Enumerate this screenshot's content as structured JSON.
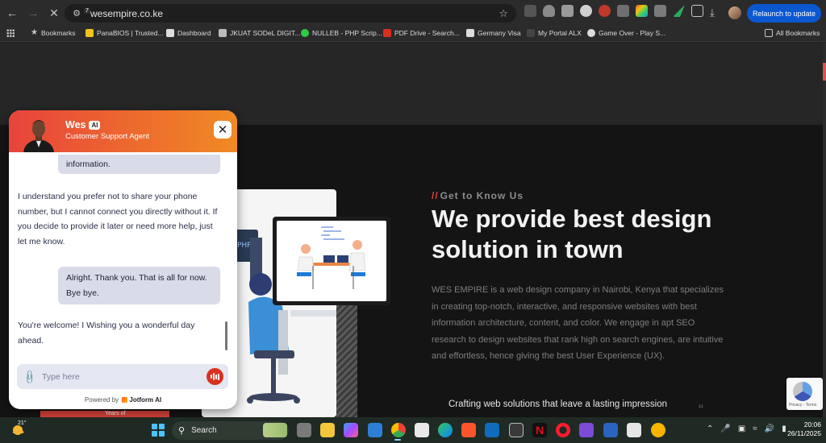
{
  "browser": {
    "url": "wesempire.co.ke",
    "relaunch_label": "Relaunch to update",
    "extension_badge": "7",
    "bookmarks": [
      {
        "label": "Bookmarks",
        "color": "#c7c7c7"
      },
      {
        "label": "PanaBIOS | Trusted...",
        "color": "#f0c419"
      },
      {
        "label": "Dashboard",
        "color": "#dddddd"
      },
      {
        "label": "JKUAT SODeL DIGIT...",
        "color": "#bbbbbb"
      },
      {
        "label": "NULLEB - PHP Scrip...",
        "color": "#2ecc40"
      },
      {
        "label": "PDF Drive - Search...",
        "color": "#d9301f"
      },
      {
        "label": "Germany Visa",
        "color": "#dddddd"
      },
      {
        "label": "My Portal ALX",
        "color": "#333333"
      },
      {
        "label": "Game Over - Play S...",
        "color": "#dddddd"
      }
    ],
    "all_bookmarks_label": "All Bookmarks"
  },
  "page": {
    "eyebrow": "Get to Know Us",
    "headline": "We provide best design solution in town",
    "body": "WES EMPIRE is a web design company in Nairobi, Kenya that specializes in creating top-notch, interactive, and responsive websites with best information architecture, content, and color. We engage in apt SEO research to design websites that rank high on search engines, are intuitive and effortless, hence giving the best User Experience (UX).",
    "tagline": "Crafting web solutions that leave a lasting impression",
    "quote_mark": "“",
    "strip_text": "Years of",
    "accent": "#e0423a"
  },
  "chat": {
    "agent_name": "Wes",
    "ai_badge": "AI",
    "agent_role": "Customer Support Agent",
    "messages": [
      {
        "from": "user",
        "text": "information."
      },
      {
        "from": "bot",
        "text": "I understand you prefer not to share your phone number, but I cannot connect you directly without it. If you decide to provide it later or need more help, just let me know."
      },
      {
        "from": "user",
        "text": "Alright. Thank you. That is all for now. Bye bye."
      },
      {
        "from": "bot",
        "text": "You're welcome! I Wishing you a wonderful day ahead."
      }
    ],
    "input_placeholder": "Type here",
    "powered_prefix": "Powered by",
    "powered_brand": "Jotform AI",
    "header_gradient": [
      "#e8433b",
      "#f08a24"
    ]
  },
  "recaptcha": {
    "links": "Privacy - Terms"
  },
  "taskbar": {
    "weather_temp": "21°",
    "search_label": "Search",
    "time": "20:06",
    "date": "26/11/2025"
  }
}
